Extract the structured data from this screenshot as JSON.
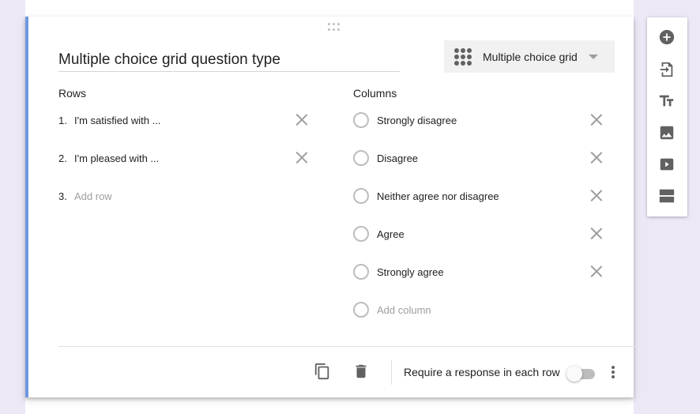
{
  "question": {
    "title": "Multiple choice grid question type",
    "type_select": {
      "selected": "Multiple choice grid",
      "icon": "grid-dots-icon"
    },
    "rows_label": "Rows",
    "columns_label": "Columns",
    "rows": [
      {
        "number": "1.",
        "text": "I'm satisfied with ..."
      },
      {
        "number": "2.",
        "text": "I'm pleased with ..."
      }
    ],
    "add_row": {
      "number": "3.",
      "placeholder": "Add row"
    },
    "columns": [
      {
        "text": "Strongly disagree"
      },
      {
        "text": "Disagree"
      },
      {
        "text": "Neither agree nor disagree"
      },
      {
        "text": "Agree"
      },
      {
        "text": "Strongly agree"
      }
    ],
    "add_column": {
      "placeholder": "Add column"
    }
  },
  "footer": {
    "duplicate_icon": "copy-icon",
    "delete_icon": "trash-icon",
    "require_label": "Require a response in each row",
    "require_toggle_on": false,
    "more_icon": "more-vert-icon"
  },
  "side_toolbar": {
    "items": [
      {
        "icon": "add-circle-icon",
        "label": "Add question"
      },
      {
        "icon": "import-icon",
        "label": "Import questions"
      },
      {
        "icon": "title-icon",
        "label": "Add title and description"
      },
      {
        "icon": "image-icon",
        "label": "Add image"
      },
      {
        "icon": "video-icon",
        "label": "Add video"
      },
      {
        "icon": "section-icon",
        "label": "Add section"
      }
    ]
  },
  "colors": {
    "accent": "#6f99e0",
    "background": "#ede7f6",
    "icon": "#616161"
  }
}
